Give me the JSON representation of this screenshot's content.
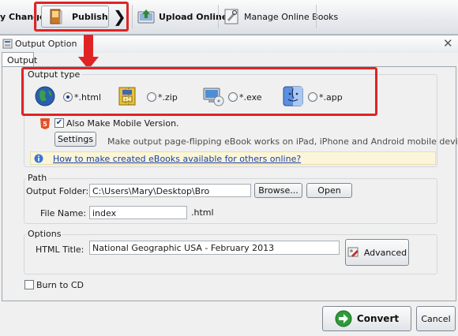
{
  "toolbar": {
    "partial_label": "y Change",
    "publish_label": "Publish",
    "chevron": "❯",
    "upload_label": "Upload Online",
    "manage_label": "Manage Online Books"
  },
  "dialog": {
    "title": "Output Option",
    "close_glyph": "✕",
    "tab_label": "Output"
  },
  "output_type": {
    "legend": "Output type",
    "options": [
      {
        "label": "*.html",
        "selected": true,
        "icon": "globe-icon"
      },
      {
        "label": "*.zip",
        "selected": false,
        "icon": "zip-archive-icon"
      },
      {
        "label": "*.exe",
        "selected": false,
        "icon": "computer-disc-icon"
      },
      {
        "label": "*.app",
        "selected": false,
        "icon": "mac-finder-icon"
      }
    ],
    "mobile_checkbox_label": "Also Make Mobile Version.",
    "mobile_checked": true,
    "settings_label": "Settings",
    "settings_hint": "Make output page-flipping eBook works on iPad, iPhone and Android mobile devices",
    "info_link": "How to make created eBooks available for others online?",
    "html5_badge": "5"
  },
  "path": {
    "legend": "Path",
    "output_folder_label": "Output Folder:",
    "output_folder_value": "C:\\Users\\Mary\\Desktop\\Bro",
    "browse_label": "Browse...",
    "open_label": "Open",
    "file_name_label": "File Name:",
    "file_name_value": "index",
    "file_ext": ".html"
  },
  "options": {
    "legend": "Options",
    "html_title_label": "HTML Title:",
    "html_title_value": "National Geographic USA - February 2013",
    "advanced_label": "Advanced"
  },
  "burn_to_cd_label": "Burn to CD",
  "burn_checked": false,
  "convert_label": "Convert",
  "cancel_label": "Cancel",
  "colors": {
    "highlight_red": "#e02424",
    "link_blue": "#1a3fa8",
    "convert_green": "#2f9a3a"
  }
}
